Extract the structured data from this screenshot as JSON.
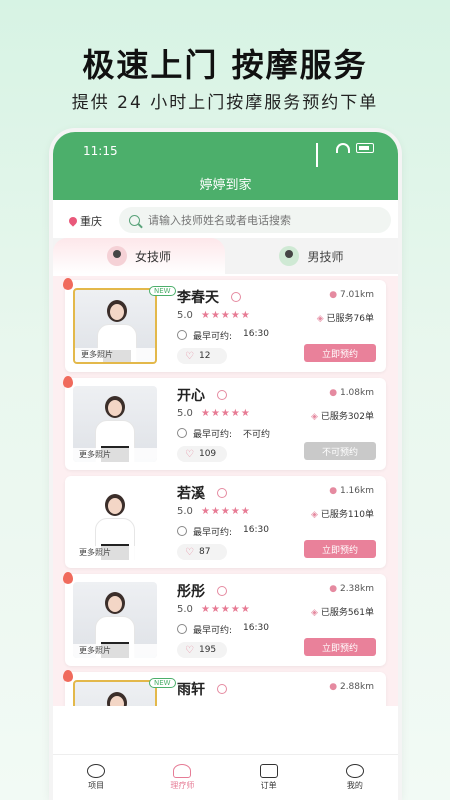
{
  "promo": {
    "title": "极速上门 按摩服务",
    "subtitle": "提供 24 小时上门按摩服务预约下单"
  },
  "status": {
    "time": "11:15"
  },
  "app": {
    "title": "婷婷到家"
  },
  "search": {
    "city": "重庆",
    "placeholder": "请输入技师姓名或者电话搜索"
  },
  "tabs": {
    "female": "女技师",
    "male": "男技师"
  },
  "cards": [
    {
      "name": "李春天",
      "rating": "5.0",
      "distance": "7.01km",
      "served": "已服务76单",
      "earliest_label": "最早可约:",
      "earliest": "16:30",
      "likes": "12",
      "button": "立即预约",
      "more": "更多照片",
      "new_badge": "NEW"
    },
    {
      "name": "开心",
      "rating": "5.0",
      "distance": "1.08km",
      "served": "已服务302单",
      "earliest_label": "最早可约:",
      "earliest": "不可约",
      "likes": "109",
      "button": "不可预约",
      "more": "更多照片"
    },
    {
      "name": "若溪",
      "rating": "5.0",
      "distance": "1.16km",
      "served": "已服务110单",
      "earliest_label": "最早可约:",
      "earliest": "16:30",
      "likes": "87",
      "button": "立即预约",
      "more": "更多照片"
    },
    {
      "name": "彤彤",
      "rating": "5.0",
      "distance": "2.38km",
      "served": "已服务561单",
      "earliest_label": "最早可约:",
      "earliest": "16:30",
      "likes": "195",
      "button": "立即预约",
      "more": "更多照片"
    },
    {
      "name": "雨轩",
      "distance": "2.88km",
      "new_badge": "NEW"
    }
  ],
  "nav": [
    {
      "label": "项目",
      "icon": "chat-icon"
    },
    {
      "label": "理疗师",
      "icon": "therapist-icon"
    },
    {
      "label": "订单",
      "icon": "order-icon"
    },
    {
      "label": "我的",
      "icon": "user-icon"
    }
  ],
  "colors": {
    "green": "#4caf6b",
    "pink": "#e9819a"
  }
}
